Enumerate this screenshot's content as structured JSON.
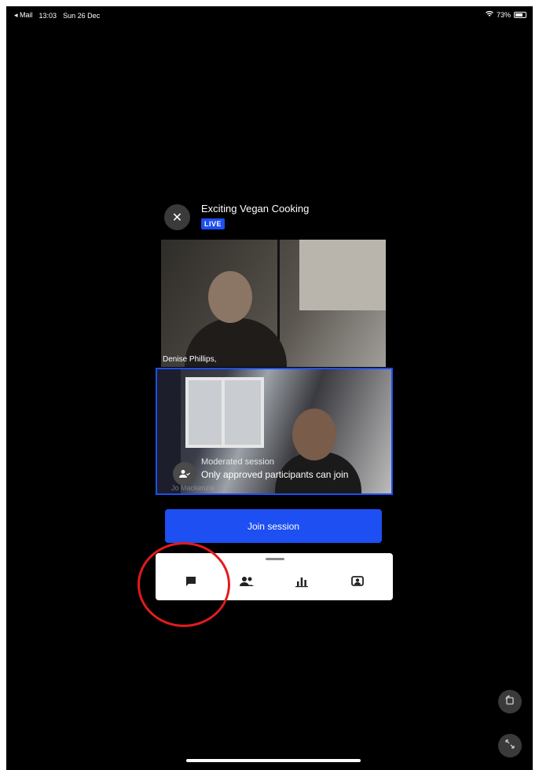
{
  "status_bar": {
    "back_app": "◂ Mail",
    "time": "13:03",
    "date": "Sun 26 Dec",
    "battery_percent": "73%",
    "battery_level": 0.73
  },
  "session": {
    "title": "Exciting Vegan Cooking",
    "live_label": "LIVE"
  },
  "videos": [
    {
      "participant": "Denise Phillips,"
    },
    {
      "participant": "Jo Mackenzie"
    }
  ],
  "moderated": {
    "title": "Moderated session",
    "description": "Only approved participants can join"
  },
  "join_button": "Join session",
  "bottom_panel": {
    "icons": [
      "chat-icon",
      "people-icon",
      "poll-icon",
      "qna-icon"
    ]
  },
  "colors": {
    "accent": "#1d4ff2",
    "highlight": "#e31b1b",
    "background": "#000000"
  }
}
